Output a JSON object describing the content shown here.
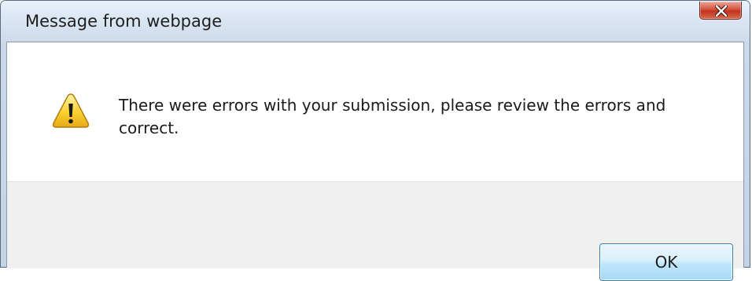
{
  "dialog": {
    "title": "Message from webpage",
    "icon": "warning-icon",
    "message": "There were errors with your submission, please review the errors and correct.",
    "ok_label": "OK"
  },
  "colors": {
    "titlebar": "#d9e4f2",
    "close_button": "#c8422a",
    "footer": "#f0f0f0",
    "ok_button_border": "#3c7fb1"
  }
}
